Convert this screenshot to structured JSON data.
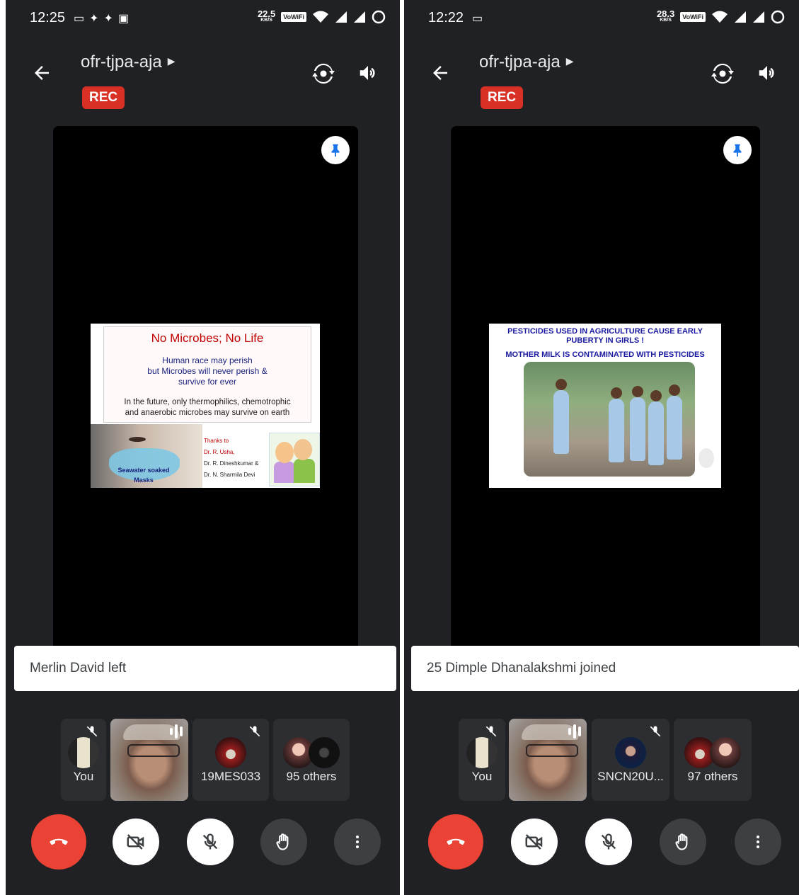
{
  "screens": [
    {
      "status": {
        "time": "12:25",
        "speed_value": "22.5",
        "speed_unit": "KB/S",
        "wifi_badge": "VoWiFi"
      },
      "meeting": {
        "code": "ofr-tjpa-aja",
        "rec_label": "REC"
      },
      "slide": {
        "title": "No Microbes; No Life",
        "line1": "Human race may perish",
        "line2": "but Microbes will never perish &",
        "line3": "survive for ever",
        "note1": "In the future, only thermophilics, chemotrophic",
        "note2": "and anaerobic microbes may survive on earth",
        "mask_label1": "Seawater soaked",
        "mask_label2": "Masks",
        "thanks": [
          "Thanks to",
          "Dr. R. Usha,",
          "Dr. R. Dineshkumar &",
          "Dr. N. Sharmila Devi"
        ]
      },
      "toast": "Merlin David left",
      "participants": {
        "you": "You",
        "third": "19MES033",
        "others": "95 others"
      }
    },
    {
      "status": {
        "time": "12:22",
        "speed_value": "28.3",
        "speed_unit": "KB/S",
        "wifi_badge": "VoWiFi"
      },
      "meeting": {
        "code": "ofr-tjpa-aja",
        "rec_label": "REC"
      },
      "slide": {
        "title1": "PESTICIDES  USED IN AGRICULTURE  CAUSE EARLY",
        "title2": "PUBERTY IN GIRLS !",
        "subtitle": "MOTHER MILK IS CONTAMINATED WITH  PESTICIDES"
      },
      "toast": "25 Dimple Dhanalakshmi joined",
      "participants": {
        "you": "You",
        "third": "SNCN20U...",
        "others": "97 others"
      }
    }
  ],
  "icons": {
    "back": "arrow-left-icon",
    "switch_camera": "switch-camera-icon",
    "speaker": "speaker-icon",
    "pin": "pin-icon",
    "end_call": "end-call-icon",
    "camera_off": "camera-off-icon",
    "mic_off": "mic-off-icon",
    "raise_hand": "raise-hand-icon",
    "more": "more-vert-icon"
  },
  "colors": {
    "background": "#202124",
    "rec": "#d93025",
    "end_call": "#ea4335",
    "pin_icon": "#1a73e8"
  }
}
